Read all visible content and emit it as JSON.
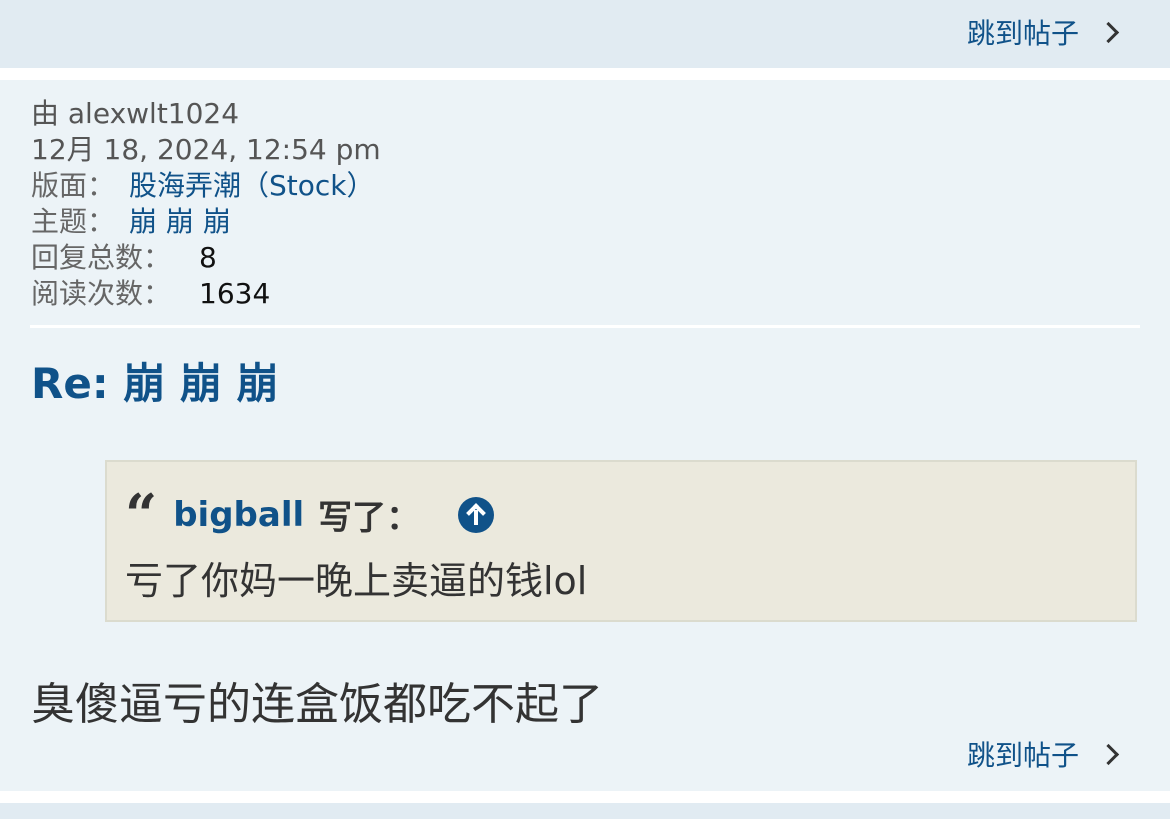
{
  "nav": {
    "jump_to_post": "跳到帖子"
  },
  "post": {
    "author_line": "由 alexwlt1024",
    "datetime": "12月 18, 2024, 12:54 pm",
    "forum_label": "版面：",
    "forum_value": "股海弄潮（Stock）",
    "topic_label": "主题：",
    "topic_value": "崩 崩 崩",
    "replies_label": "回复总数：",
    "replies_value": "8",
    "views_label": "阅读次数：",
    "views_value": "1634",
    "title": "Re: 崩 崩 崩",
    "quote": {
      "icon": "quote-icon",
      "author": "bigball",
      "wrote": "写了：",
      "text": "亏了你妈一晚上卖逼的钱lol"
    },
    "body": "臭傻逼亏的连盒饭都吃不起了"
  },
  "colors": {
    "link": "#105289",
    "post_bg": "#ecf3f7",
    "band_bg": "#e1ebf2",
    "quote_bg": "#ebe9dd"
  }
}
